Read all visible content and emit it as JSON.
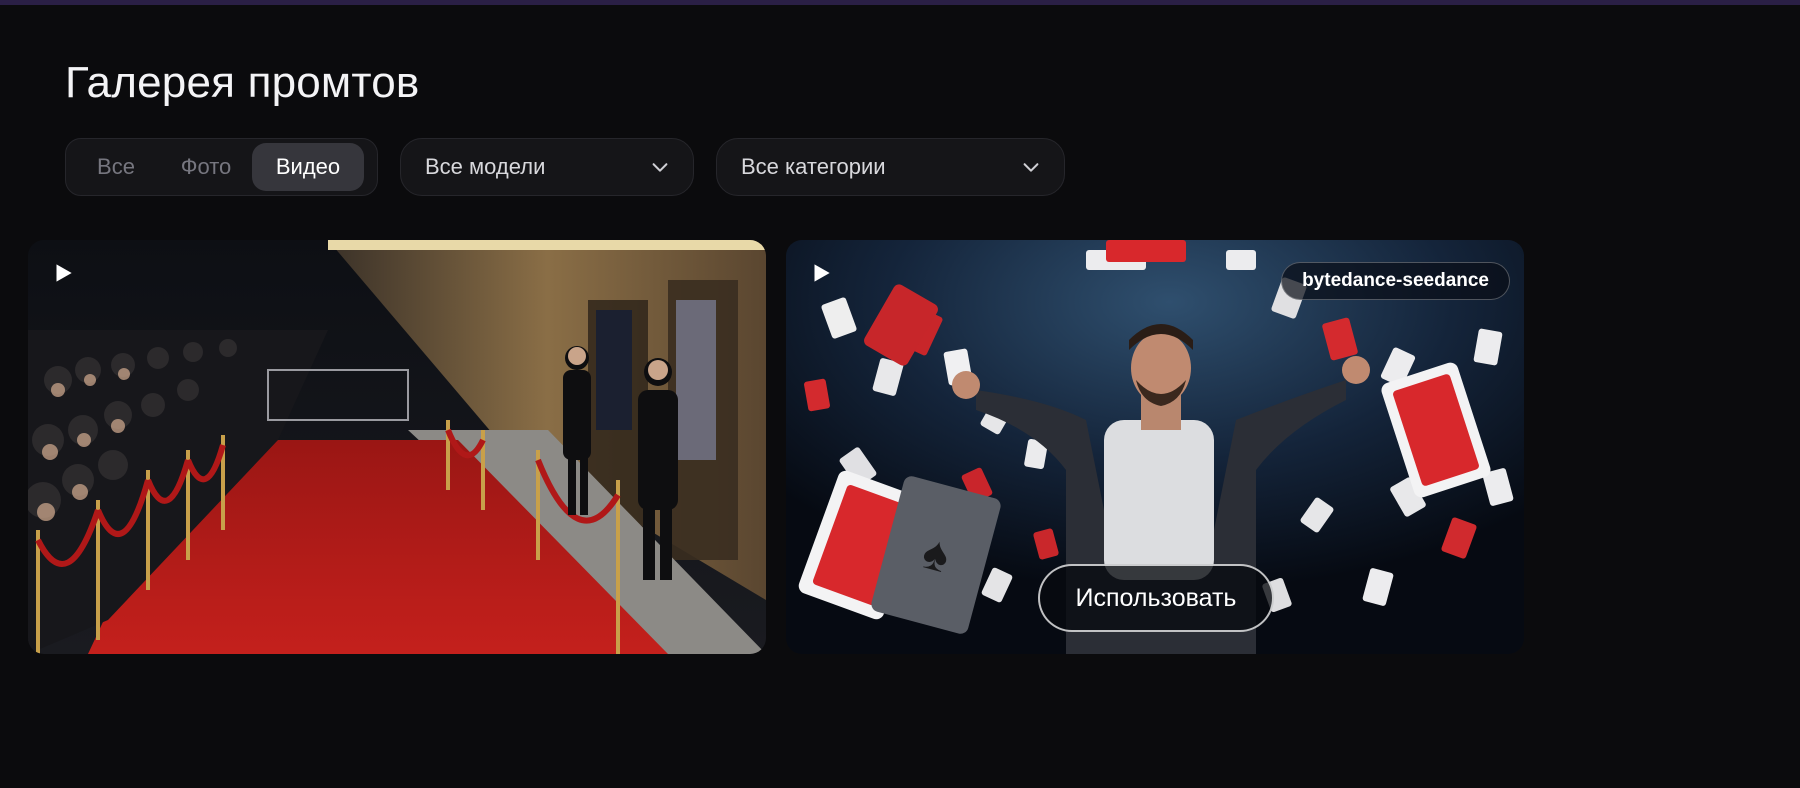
{
  "header": {
    "title": "Галерея промтов"
  },
  "filters": {
    "media_types": [
      "Все",
      "Фото",
      "Видео"
    ],
    "selected_media_type": "Видео",
    "model_dropdown": {
      "value": "Все модели",
      "icon": "chevron-down-icon"
    },
    "category_dropdown": {
      "value": "Все категории",
      "icon": "chevron-down-icon"
    }
  },
  "gallery": {
    "cards": [
      {
        "type": "video",
        "icon": "play-icon",
        "scene": "red-carpet-premiere"
      },
      {
        "type": "video",
        "icon": "play-icon",
        "scene": "man-with-flying-playing-cards",
        "model_badge": "bytedance-seedance",
        "action_label": "Использовать"
      }
    ]
  },
  "colors": {
    "background": "#0b0b0d",
    "control_bg": "#151518",
    "active_segment": "#36363c",
    "muted_text": "#76767f",
    "top_strip": "#2a1f45"
  }
}
